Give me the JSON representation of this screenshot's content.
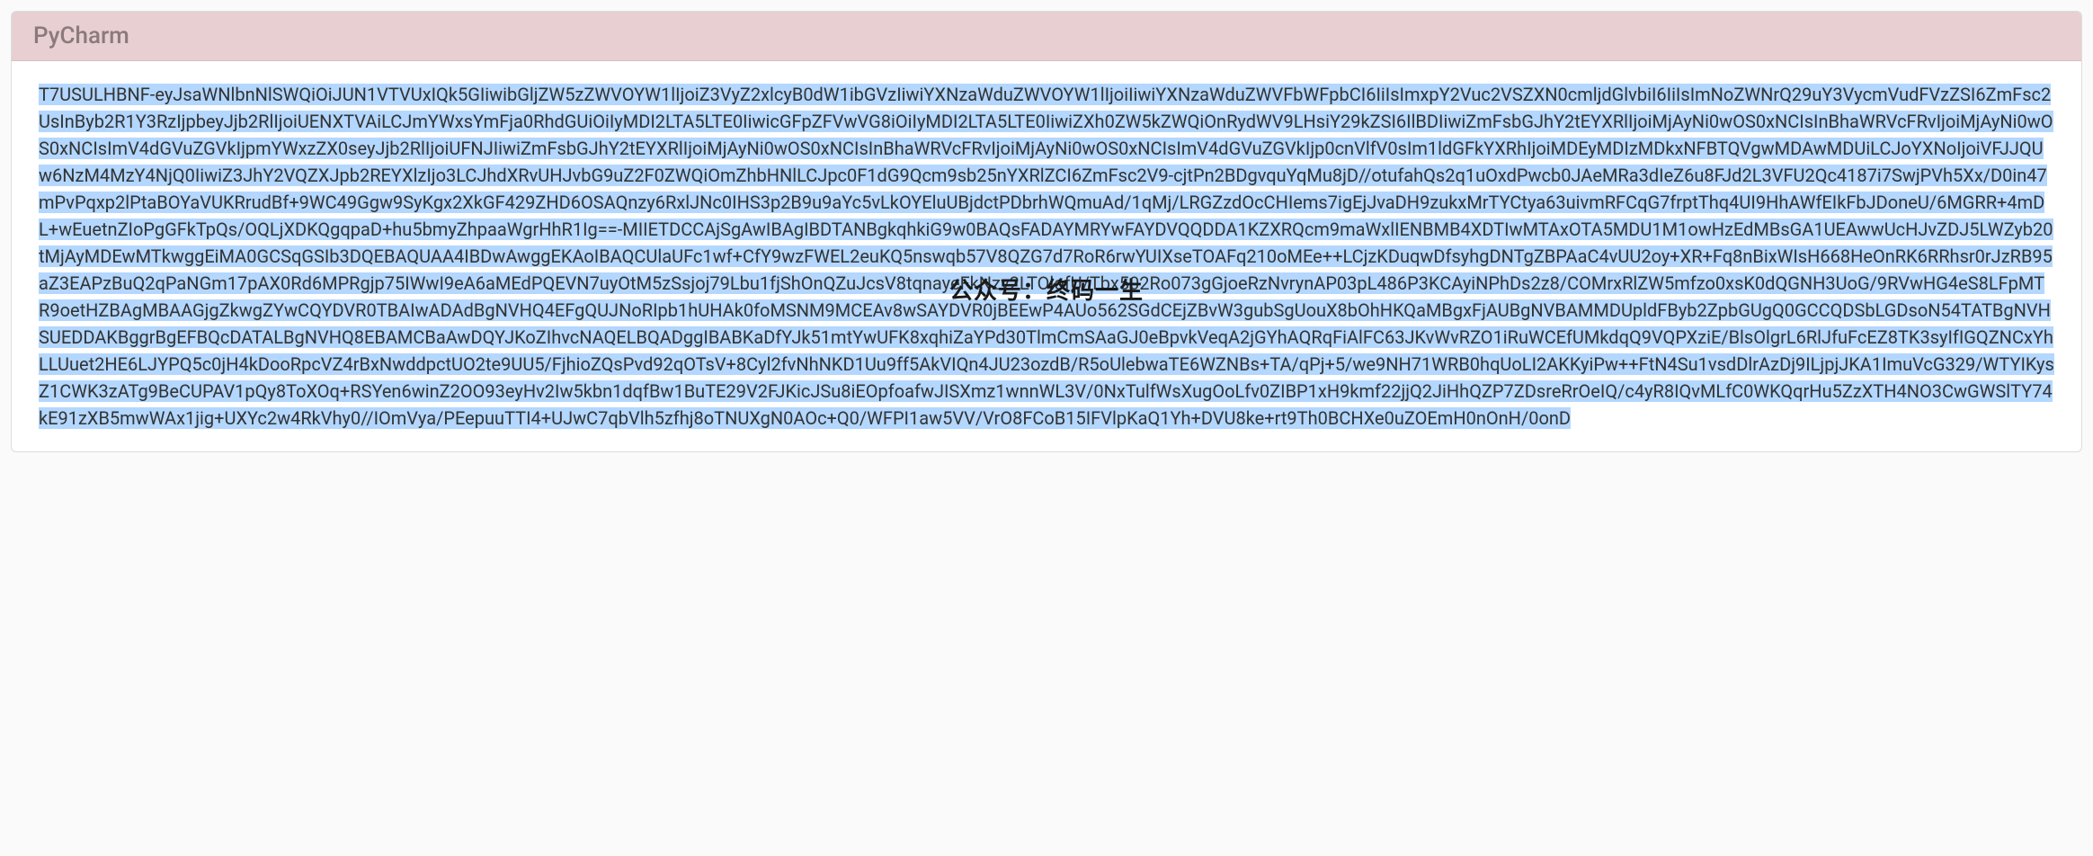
{
  "card": {
    "title": "PyCharm",
    "license_key": "T7USULHBNF-eyJsaWNlbnNlSWQiOiJUN1VTVUxIQk5GIiwibGljZW5zZWVOYW1lIjoiZ3VyZ2xlcyB0dW1ibGVzIiwiYXNzaWduZWVOYW1lIjoiIiwiYXNzaWduZWVFbWFpbCI6IiIsImxpY2Vuc2VSZXN0cmljdGlvbiI6IiIsImNoZWNrQ29uY3VycmVudFVzZSI6ZmFsc2UsInByb2R1Y3RzIjpbeyJjb2RlIjoiUENXTVAiLCJmYWxsYmFja0RhdGUiOiIyMDI2LTA5LTE0IiwicGFpZFVwVG8iOiIyMDI2LTA5LTE0IiwiZXh0ZW5kZWQiOnRydWV9LHsiY29kZSI6IlBDIiwiZmFsbGJhY2tEYXRlIjoiMjAyNi0wOS0xNCIsInBhaWRVcFRvIjoiMjAyNi0wOS0xNCIsImV4dGVuZGVkIjpmYWxzZX0seyJjb2RlIjoiUFNJIiwiZmFsbGJhY2tEYXRlIjoiMjAyNi0wOS0xNCIsInBhaWRVcFRvIjoiMjAyNi0wOS0xNCIsImV4dGVuZGVkIjp0cnVlfV0sIm1ldGFkYXRhIjoiMDEyMDIzMDkxNFBTQVgwMDAwMDUiLCJoYXNoIjoiVFJJQUw6NzM4MzY4NjQ0IiwiZ3JhY2VQZXJpb2REYXlzIjo3LCJhdXRvUHJvbG9uZ2F0ZWQiOmZhbHNlLCJpc0F1dG9Qcm9sb25nYXRlZCI6ZmFsc2V9-cjtPn2BDgvquYqMu8jD//otufahQs2q1uOxdPwcb0JAeMRa3dIeZ6u8FJd2L3VFU2Qc4187i7SwjPVh5Xx/D0in47mPvPqxp2lPtaBOYaVUKRrudBf+9WC49Ggw9SyKgx2XkGF429ZHD6OSAQnzy6RxlJNc0IHS3p2B9u9aYc5vLkOYEluUBjdctPDbrhWQmuAd/1qMj/LRGZzdOcCHIems7igEjJvaDH9zukxMrTYCtya63uivmRFCqG7frptThq4UI9HhAWfEIkFbJDoneU/6MGRR+4mDL+wEuetnZIoPgGFkTpQs/OQLjXDKQgqpaD+hu5bmyZhpaaWgrHhR1Ig==-MIIETDCCAjSgAwIBAgIBDTANBgkqhkiG9w0BAQsFADAYMRYwFAYDVQQDDA1KZXRQcm9maWxlIENBMB4XDTIwMTAxOTA5MDU1M1owHzEdMBsGA1UEAwwUcHJvZDJ5LWZyb20tMjAyMDEwMTkwggEiMA0GCSqGSIb3DQEBAQUAA4IBDwAwggEKAoIBAQCUlaUFc1wf+CfY9wzFWEL2euKQ5nswqb57V8QZG7d7RoR6rwYUIXseTOAFq210oMEe++LCjzKDuqwDfsyhgDNTgZBPAaC4vUU2oy+XR+Fq8nBixWIsH668HeOnRK6RRhsr0rJzRB95aZ3EAPzBuQ2qPaNGm17pAX0Rd6MPRgjp75IWwI9eA6aMEdPQEVN7uyOtM5zSsjoj79Lbu1fjShOnQZuJcsV8tqnayeFkNzv2LTOlofU/Tbx502Ro073gGjoeRzNvrynAP03pL486P3KCAyiNPhDs2z8/COMrxRlZW5mfzo0xsK0dQGNH3UoG/9RVwHG4eS8LFpMTR9oetHZBAgMBAAGjgZkwgZYwCQYDVR0TBAIwADAdBgNVHQ4EFgQUJNoRIpb1hUHAk0foMSNM9MCEAv8wSAYDVR0jBEEwP4AUo562SGdCEjZBvW3gubSgUouX8bOhHKQaMBgxFjAUBgNVBAMMDUpldFByb2ZpbGUgQ0GCCQDSbLGDsoN54TATBgNVHSUEDDAKBggrBgEFBQcDATALBgNVHQ8EBAMCBaAwDQYJKoZIhvcNAQELBQADggIBABKaDfYJk51mtYwUFK8xqhiZaYPd30TlmCmSAaGJ0eBpvkVeqA2jGYhAQRqFiAlFC63JKvWvRZO1iRuWCEfUMkdqQ9VQPXziE/BlsOlgrL6RlJfuFcEZ8TK3syIfIGQZNCxYhLLUuet2HE6LJYPQ5c0jH4kDooRpcVZ4rBxNwddpctUO2te9UU5/FjhioZQsPvd92qOTsV+8Cyl2fvNhNKD1Uu9ff5AkVIQn4JU23ozdB/R5oUlebwaTE6WZNBs+TA/qPj+5/we9NH71WRB0hqUoLI2AKKyiPw++FtN4Su1vsdDlrAzDj9ILjpjJKA1ImuVcG329/WTYIKysZ1CWK3zATg9BeCUPAV1pQy8ToXOq+RSYen6winZ2OO93eyHv2Iw5kbn1dqfBw1BuTE29V2FJKicJSu8iEOpfoafwJISXmz1wnnWL3V/0NxTulfWsXugOoLfv0ZIBP1xH9kmf22jjQ2JiHhQZP7ZDsreRrOeIQ/c4yR8IQvMLfC0WKQqrHu5ZzXTH4NO3CwGWSlTY74kE91zXB5mwWAx1jig+UXYc2w4RkVhy0//IOmVya/PEepuuTTI4+UJwC7qbVlh5zfhj8oTNUXgN0AOc+Q0/WFPI1aw5VV/VrO8FCoB15IFVlpKaQ1Yh+DVU8ke+rt9Th0BCHXe0uZOEmH0nOnH/0onD"
  },
  "watermark": {
    "text": "公众号：终码一生"
  }
}
